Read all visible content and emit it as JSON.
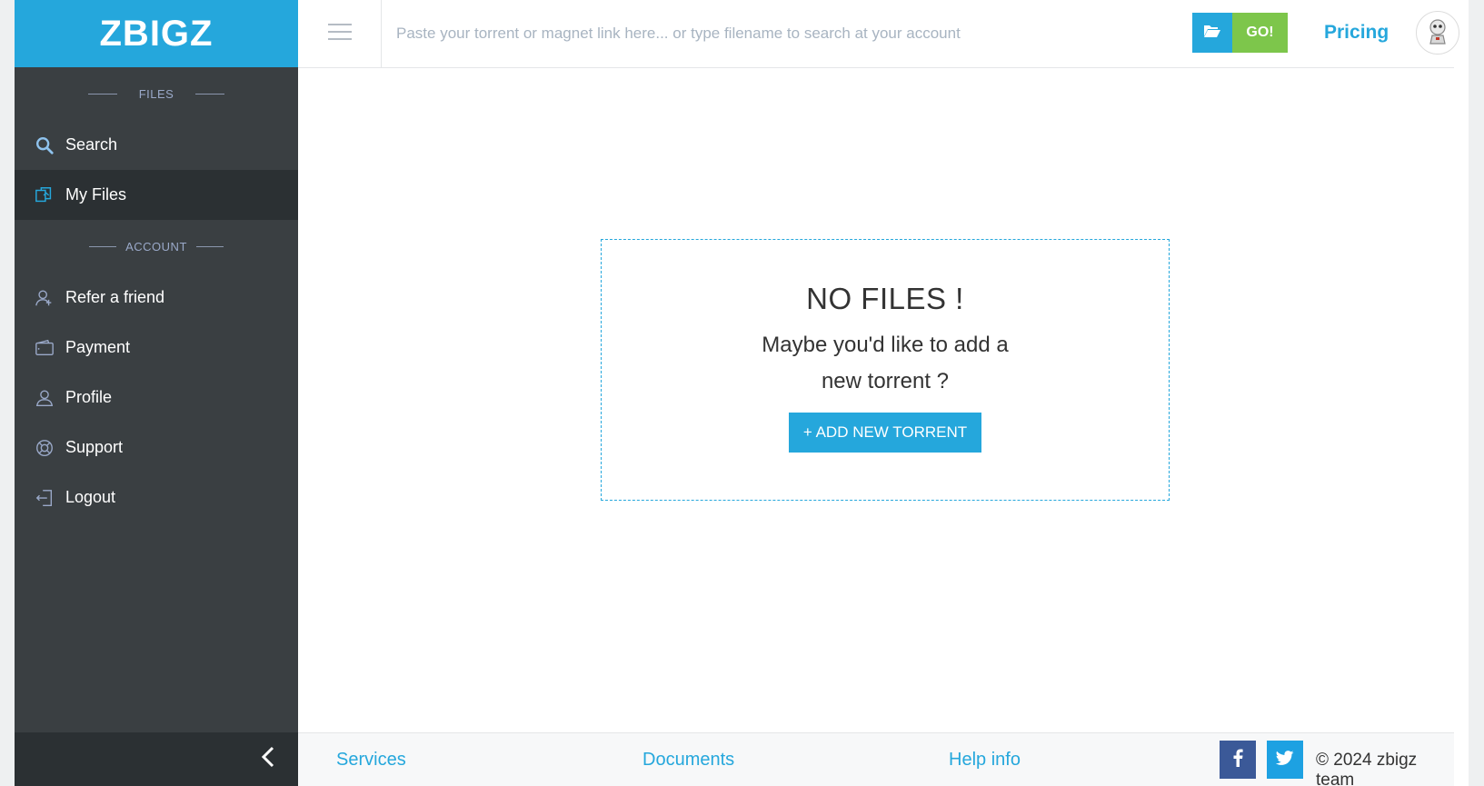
{
  "brand": {
    "name": "ZBIGZ",
    "color": "#25a7dc"
  },
  "sidebar": {
    "files_section": "FILES",
    "account_section": "ACCOUNT",
    "files_items": [
      {
        "label": "Search",
        "icon": "search-icon"
      },
      {
        "label": "My Files",
        "icon": "files-icon",
        "active": true
      }
    ],
    "account_items": [
      {
        "label": "Refer a friend",
        "icon": "refer-friend-icon"
      },
      {
        "label": "Payment",
        "icon": "wallet-icon"
      },
      {
        "label": "Profile",
        "icon": "user-icon"
      },
      {
        "label": "Support",
        "icon": "lifebuoy-icon"
      },
      {
        "label": "Logout",
        "icon": "logout-icon"
      }
    ]
  },
  "header": {
    "search_placeholder": "Paste your torrent or magnet link here... or type filename to search at your account",
    "go_label": "GO!",
    "pricing_label": "Pricing"
  },
  "main": {
    "empty_title": "NO FILES !",
    "empty_subtitle": "Maybe you'd like to add a new torrent ?",
    "add_button": "+ ADD NEW TORRENT"
  },
  "footer": {
    "links": [
      "Services",
      "Documents",
      "Help info"
    ],
    "copyright": "© 2024 zbigz team"
  }
}
